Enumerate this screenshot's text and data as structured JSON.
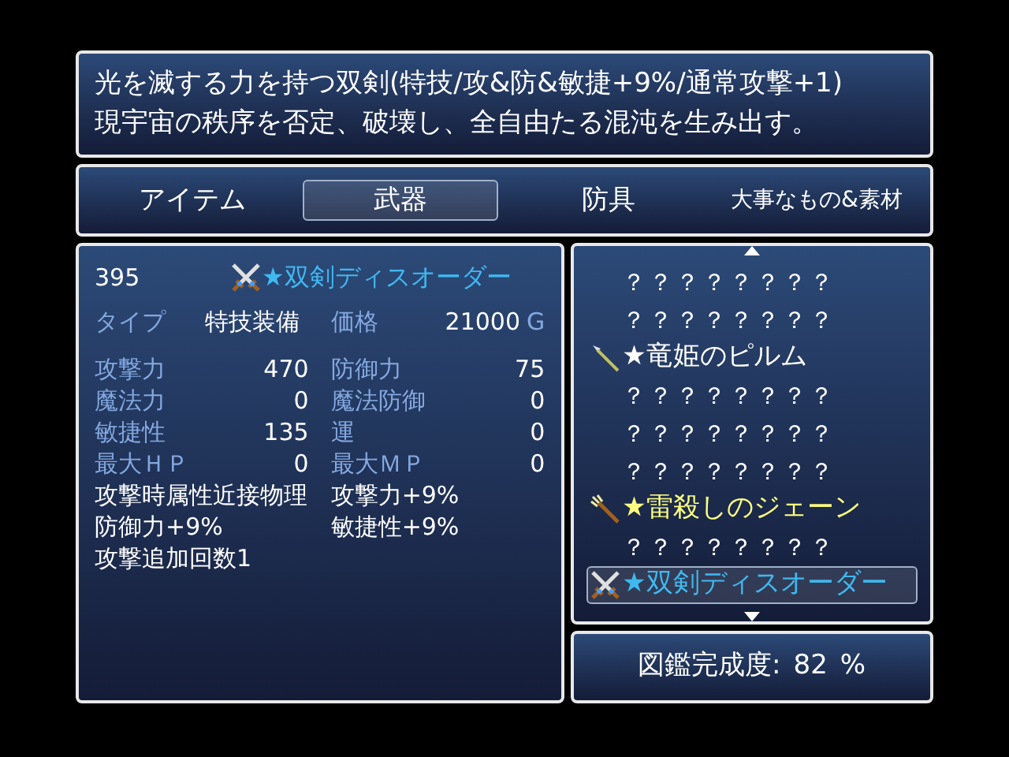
{
  "description": {
    "lines": [
      "光を滅する力を持つ双剣(特技/攻&防&敏捷+9%/通常攻撃+1)",
      "現宇宙の秩序を否定、破壊し、全自由たる混沌を生み出す。"
    ]
  },
  "tabs": [
    {
      "label": "アイテム",
      "selected": false
    },
    {
      "label": "武器",
      "selected": true
    },
    {
      "label": "防具",
      "selected": false
    },
    {
      "label": "大事なもの&素材",
      "selected": false
    }
  ],
  "detail": {
    "number": "395",
    "name": "★双剣ディスオーダー",
    "color": "#40b8f0",
    "type_label": "タイプ",
    "type_value": "特技装備",
    "price_label": "価格",
    "price_value": "21000",
    "currency": "G",
    "stats": [
      {
        "label": "攻撃力",
        "value": "470"
      },
      {
        "label": "防御力",
        "value": "75"
      },
      {
        "label": "魔法力",
        "value": "0"
      },
      {
        "label": "魔法防御",
        "value": "0"
      },
      {
        "label": "敏捷性",
        "value": "135"
      },
      {
        "label": "運",
        "value": "0"
      },
      {
        "label": "最大ＨＰ",
        "value": "0"
      },
      {
        "label": "最大ＭＰ",
        "value": "0"
      }
    ],
    "effects": [
      "攻撃時属性近接物理",
      "攻撃力+9%",
      "防御力+9%",
      "敏捷性+9%",
      "攻撃追加回数1"
    ]
  },
  "list": {
    "items": [
      {
        "kind": "unknown",
        "name": "？？？？？？？？",
        "color": "#ffffff",
        "selected": false
      },
      {
        "kind": "unknown",
        "name": "？？？？？？？？",
        "color": "#ffffff",
        "selected": false
      },
      {
        "kind": "spear",
        "name": "★竜姫のピルム",
        "color": "#ffffff",
        "selected": false
      },
      {
        "kind": "unknown",
        "name": "？？？？？？？？",
        "color": "#ffffff",
        "selected": false
      },
      {
        "kind": "unknown",
        "name": "？？？？？？？？",
        "color": "#ffffff",
        "selected": false
      },
      {
        "kind": "unknown",
        "name": "？？？？？？？？",
        "color": "#ffffff",
        "selected": false
      },
      {
        "kind": "trident",
        "name": "★雷殺しのジェーン",
        "color": "#ffff80",
        "selected": false
      },
      {
        "kind": "unknown",
        "name": "？？？？？？？？",
        "color": "#ffffff",
        "selected": false
      },
      {
        "kind": "swords",
        "name": "★双剣ディスオーダー",
        "color": "#40b8f0",
        "selected": true
      }
    ]
  },
  "completion": {
    "label": "図鑑完成度:",
    "value": "82",
    "unit": "%"
  }
}
